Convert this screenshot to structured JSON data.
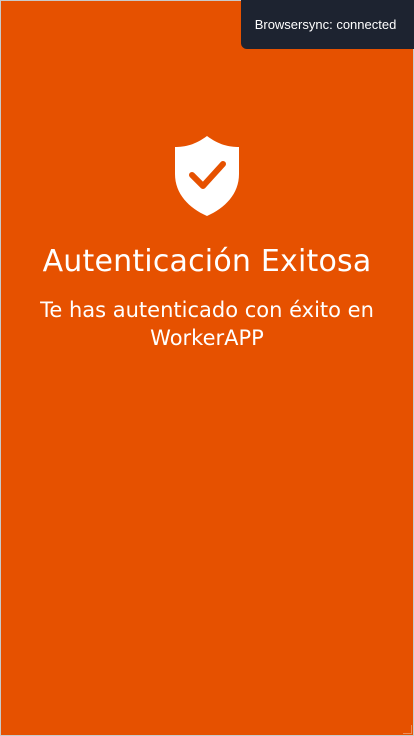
{
  "colors": {
    "background": "#e65100",
    "toast_background": "#1d2330",
    "text": "#ffffff"
  },
  "toast": {
    "text": "Browsersync: connected"
  },
  "main": {
    "icon": "shield-check-icon",
    "title": "Autenticación Exitosa",
    "message": "Te has autenticado con éxito en WorkerAPP"
  }
}
